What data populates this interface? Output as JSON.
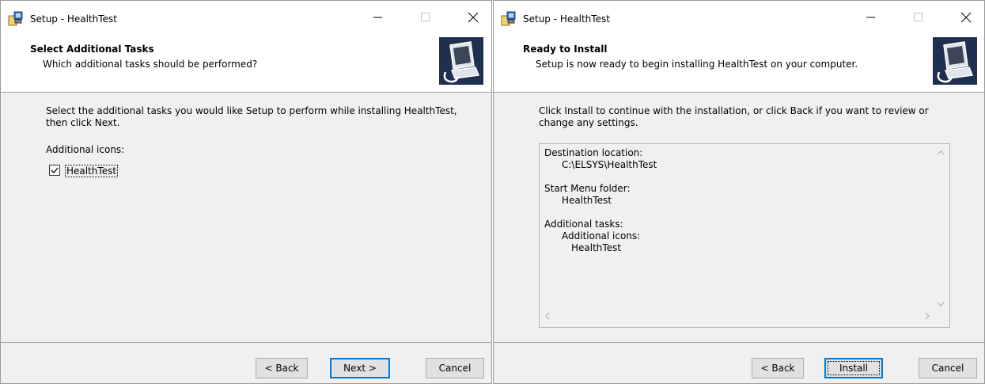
{
  "windows": [
    {
      "title": "Setup - HealthTest",
      "header_title": "Select Additional Tasks",
      "header_subtitle": "Which additional tasks should be performed?",
      "description_line1": "Select the additional tasks you would like Setup to perform while installing HealthTest,",
      "description_line2": "then click Next.",
      "group_label": "Additional icons:",
      "checkbox": {
        "label": "HealthTest",
        "checked": true
      },
      "buttons": {
        "back": "< Back",
        "next": "Next >",
        "cancel": "Cancel"
      }
    },
    {
      "title": "Setup - HealthTest",
      "header_title": "Ready to Install",
      "header_subtitle": "Setup is now ready to begin installing HealthTest on your computer.",
      "description_line1": "Click Install to continue with the installation, or click Back if you want to review or",
      "description_line2": "change any settings.",
      "summary": [
        "Destination location:",
        "C:\\ELSYS\\HealthTest",
        "Start Menu folder:",
        "HealthTest",
        "Additional tasks:",
        "Additional icons:",
        "HealthTest"
      ],
      "buttons": {
        "back": "< Back",
        "install": "Install",
        "cancel": "Cancel"
      }
    }
  ],
  "icons": [
    "setup-app-icon",
    "minimize-icon",
    "maximize-icon",
    "close-icon",
    "wizard-computer-icon",
    "checkmark-icon",
    "scroll-up-icon",
    "scroll-down-icon",
    "scroll-left-icon",
    "scroll-right-icon"
  ],
  "colors": {
    "accent": "#0078d7",
    "window_bg": "#f0f0f0",
    "header_bg": "#ffffff"
  }
}
